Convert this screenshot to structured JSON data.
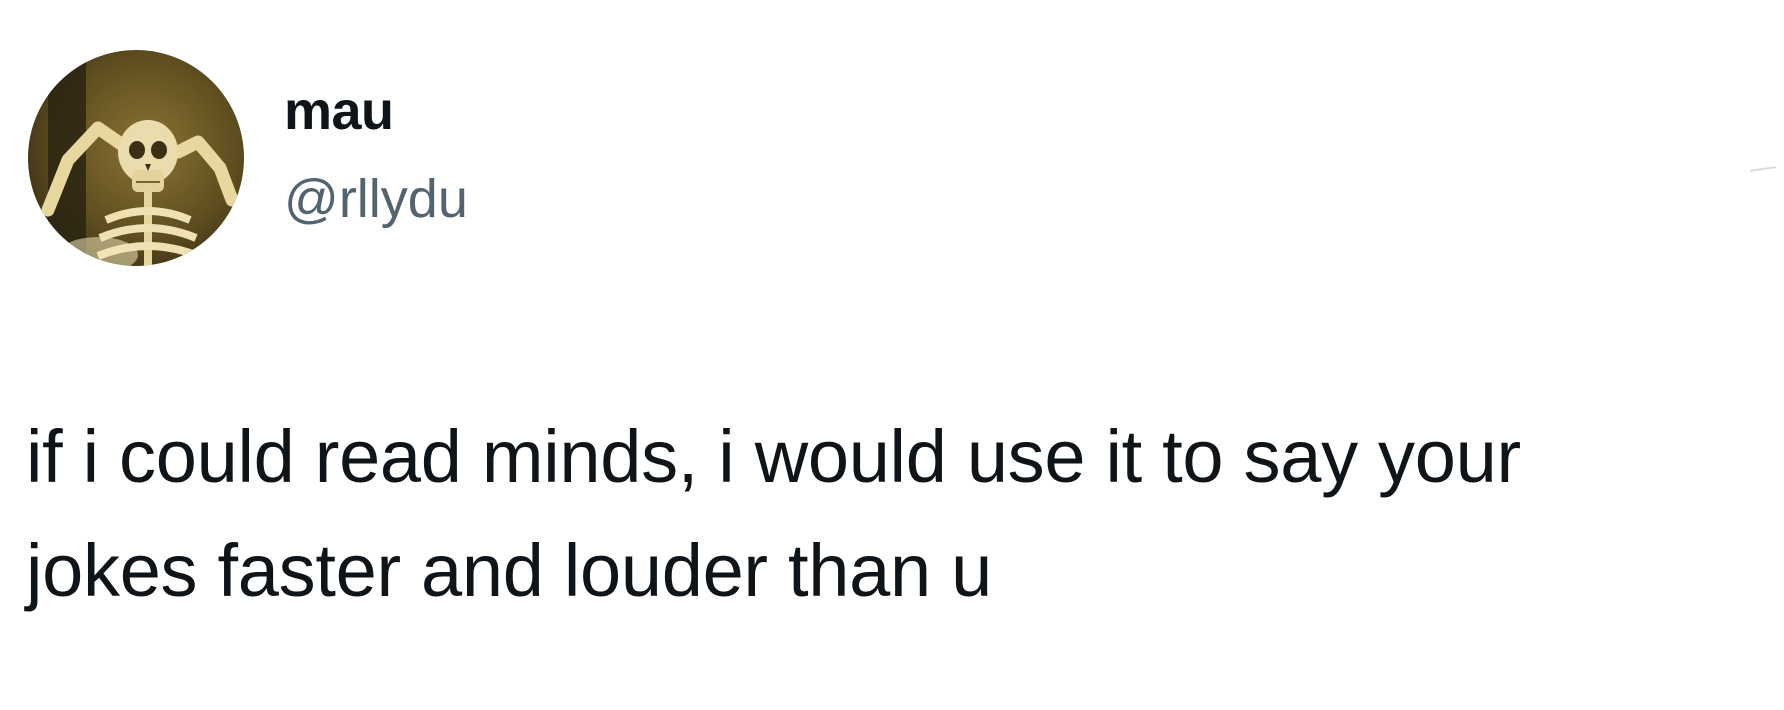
{
  "author": {
    "display_name": "mau",
    "handle": "@rllydu",
    "avatar_icon": "skeleton-avatar-icon"
  },
  "tweet": {
    "text": "if i could read minds, i would use it to say your\njokes faster and louder than u"
  },
  "colors": {
    "background": "#ffffff",
    "text_primary": "#0f1419",
    "text_secondary": "#536471"
  }
}
